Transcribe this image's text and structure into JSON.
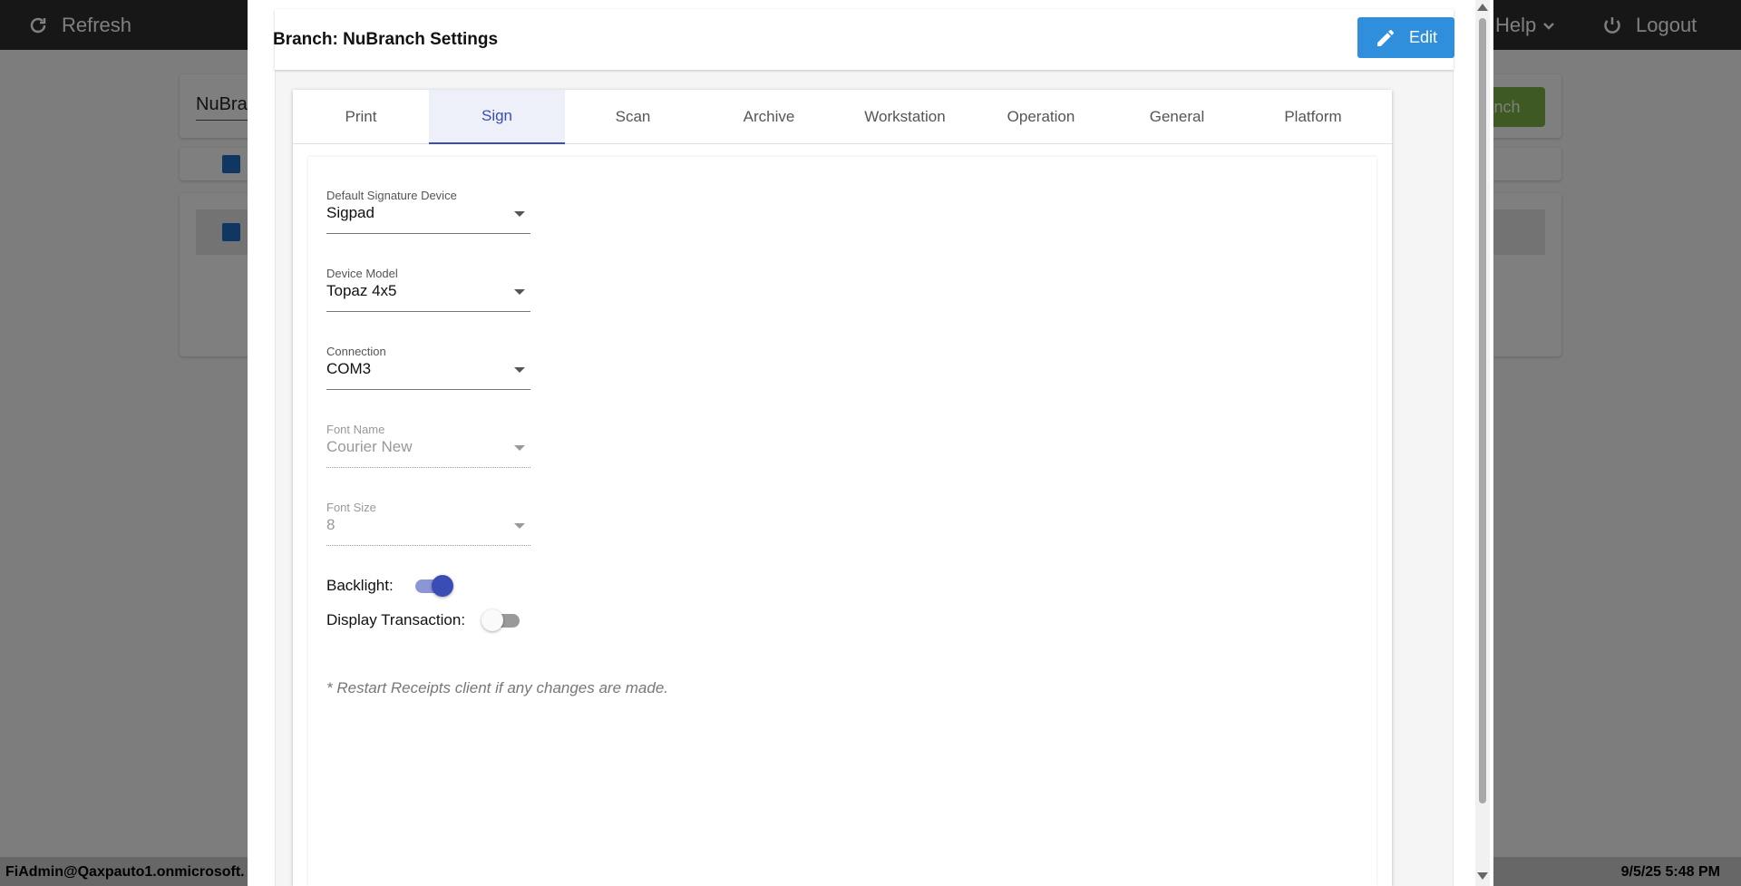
{
  "topbar": {
    "refresh_label": "Refresh",
    "help_label": "Help",
    "logout_label": "Logout"
  },
  "background": {
    "search_text": "NuBra",
    "green_button_partial": "anch"
  },
  "modal": {
    "title": "Branch: NuBranch Settings",
    "edit_label": "Edit",
    "tabs": [
      {
        "label": "Print"
      },
      {
        "label": "Sign"
      },
      {
        "label": "Scan"
      },
      {
        "label": "Archive"
      },
      {
        "label": "Workstation"
      },
      {
        "label": "Operation"
      },
      {
        "label": "General"
      },
      {
        "label": "Platform"
      }
    ],
    "active_tab": "Sign",
    "fields": {
      "signature_device": {
        "label": "Default Signature Device",
        "value": "Sigpad"
      },
      "device_model": {
        "label": "Device Model",
        "value": "Topaz 4x5"
      },
      "connection": {
        "label": "Connection",
        "value": "COM3"
      },
      "font_name": {
        "label": "Font Name",
        "value": "Courier New"
      },
      "font_size": {
        "label": "Font Size",
        "value": "8"
      }
    },
    "toggles": {
      "backlight": {
        "label": "Backlight:",
        "on": true
      },
      "display_transaction": {
        "label": "Display Transaction:",
        "on": false
      }
    },
    "note": "* Restart Receipts client if any changes are made."
  },
  "statusbar": {
    "user": "FiAdmin@Qaxpauto1.onmicrosoft.",
    "datetime": "9/5/25 5:48 PM"
  },
  "colors": {
    "accent": "#3a4db4",
    "edit_button": "#2f8fdc",
    "topbar": "#2f2f2f",
    "green_button": "#7cb342"
  }
}
